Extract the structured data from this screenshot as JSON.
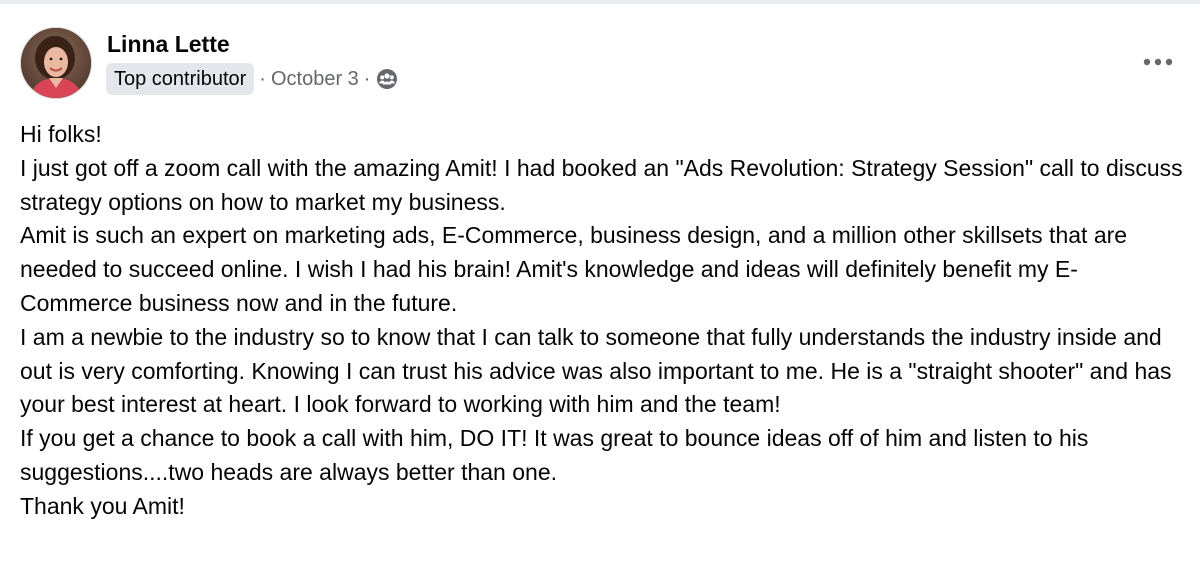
{
  "post": {
    "author": {
      "name": "Linna Lette",
      "badge": "Top contributor"
    },
    "meta": {
      "separator": "·",
      "date": "October 3",
      "audience_icon": "group-audience-icon"
    },
    "more_icon": "more-options-icon",
    "paragraphs": [
      "Hi folks!",
      "I just got off a zoom call with the amazing Amit!  I had booked an \"Ads Revolution:  Strategy Session\" call to discuss strategy options on how to market my business.",
      "Amit is such an expert on marketing ads, E-Commerce, business design, and a million other skillsets that are needed to succeed online. I wish I had his brain!  Amit's knowledge and ideas will definitely benefit my E-Commerce business now and in the future.",
      "I am a newbie to the industry so to know that I can talk to someone that fully understands the industry inside and out is very comforting.  Knowing I can trust his advice was also important to me. He is a \"straight shooter\" and has your best interest at heart.  I look forward to working with him and the team!",
      "If you get a chance to book a call with him, DO IT!  It was great to bounce ideas off of him and listen to his suggestions....two heads are always better than one.",
      "Thank you Amit!"
    ]
  },
  "colors": {
    "text": "#050505",
    "secondary_text": "#65676b",
    "badge_bg": "#e4e6eb",
    "page_bg": "#ffffff",
    "top_strip": "#e9ebee"
  }
}
